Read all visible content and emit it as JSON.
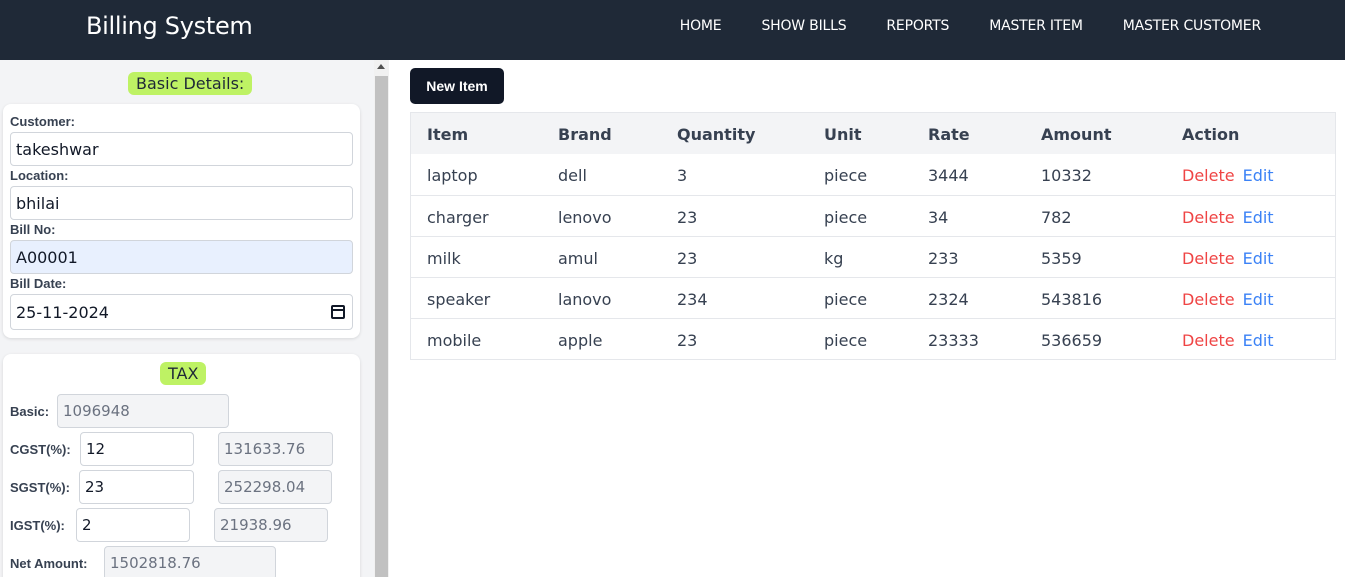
{
  "navbar": {
    "brand": "Billing System",
    "links": [
      "HOME",
      "SHOW BILLS",
      "REPORTS",
      "MASTER ITEM",
      "MASTER CUSTOMER"
    ]
  },
  "basic": {
    "heading": "Basic Details:",
    "customer_label": "Customer:",
    "customer_value": "takeshwar",
    "location_label": "Location:",
    "location_value": "bhilai",
    "billno_label": "Bill No:",
    "billno_value": "A00001",
    "billdate_label": "Bill Date:",
    "billdate_value": "25-11-2024"
  },
  "tax": {
    "heading": "TAX",
    "basic_label": "Basic:",
    "basic_value": "1096948",
    "cgst_label": "CGST(%):",
    "cgst_value": "12",
    "cgst_amount": "131633.76",
    "sgst_label": "SGST(%):",
    "sgst_value": "23",
    "sgst_amount": "252298.04",
    "igst_label": "IGST(%):",
    "igst_value": "2",
    "igst_amount": "21938.96",
    "net_label": "Net Amount:",
    "net_value": "1502818.76"
  },
  "main": {
    "new_item_label": "New Item",
    "columns": [
      "Item",
      "Brand",
      "Quantity",
      "Unit",
      "Rate",
      "Amount",
      "Action"
    ],
    "rows": [
      {
        "item": "laptop",
        "brand": "dell",
        "quantity": "3",
        "unit": "piece",
        "rate": "3444",
        "amount": "10332"
      },
      {
        "item": "charger",
        "brand": "lenovo",
        "quantity": "23",
        "unit": "piece",
        "rate": "34",
        "amount": "782"
      },
      {
        "item": "milk",
        "brand": "amul",
        "quantity": "23",
        "unit": "kg",
        "rate": "233",
        "amount": "5359"
      },
      {
        "item": "speaker",
        "brand": "lanovo",
        "quantity": "234",
        "unit": "piece",
        "rate": "2324",
        "amount": "543816"
      },
      {
        "item": "mobile",
        "brand": "apple",
        "quantity": "23",
        "unit": "piece",
        "rate": "23333",
        "amount": "536659"
      }
    ],
    "delete_label": "Delete",
    "edit_label": "Edit"
  },
  "icons": {
    "calendar": "calendar-icon",
    "scroll_up": "scroll-up-arrow-icon"
  },
  "colors": {
    "navbar_bg": "#1f2937",
    "pill_bg": "#bef264",
    "delete": "#ef4444",
    "edit": "#3b82f6",
    "button_bg": "#111827"
  }
}
